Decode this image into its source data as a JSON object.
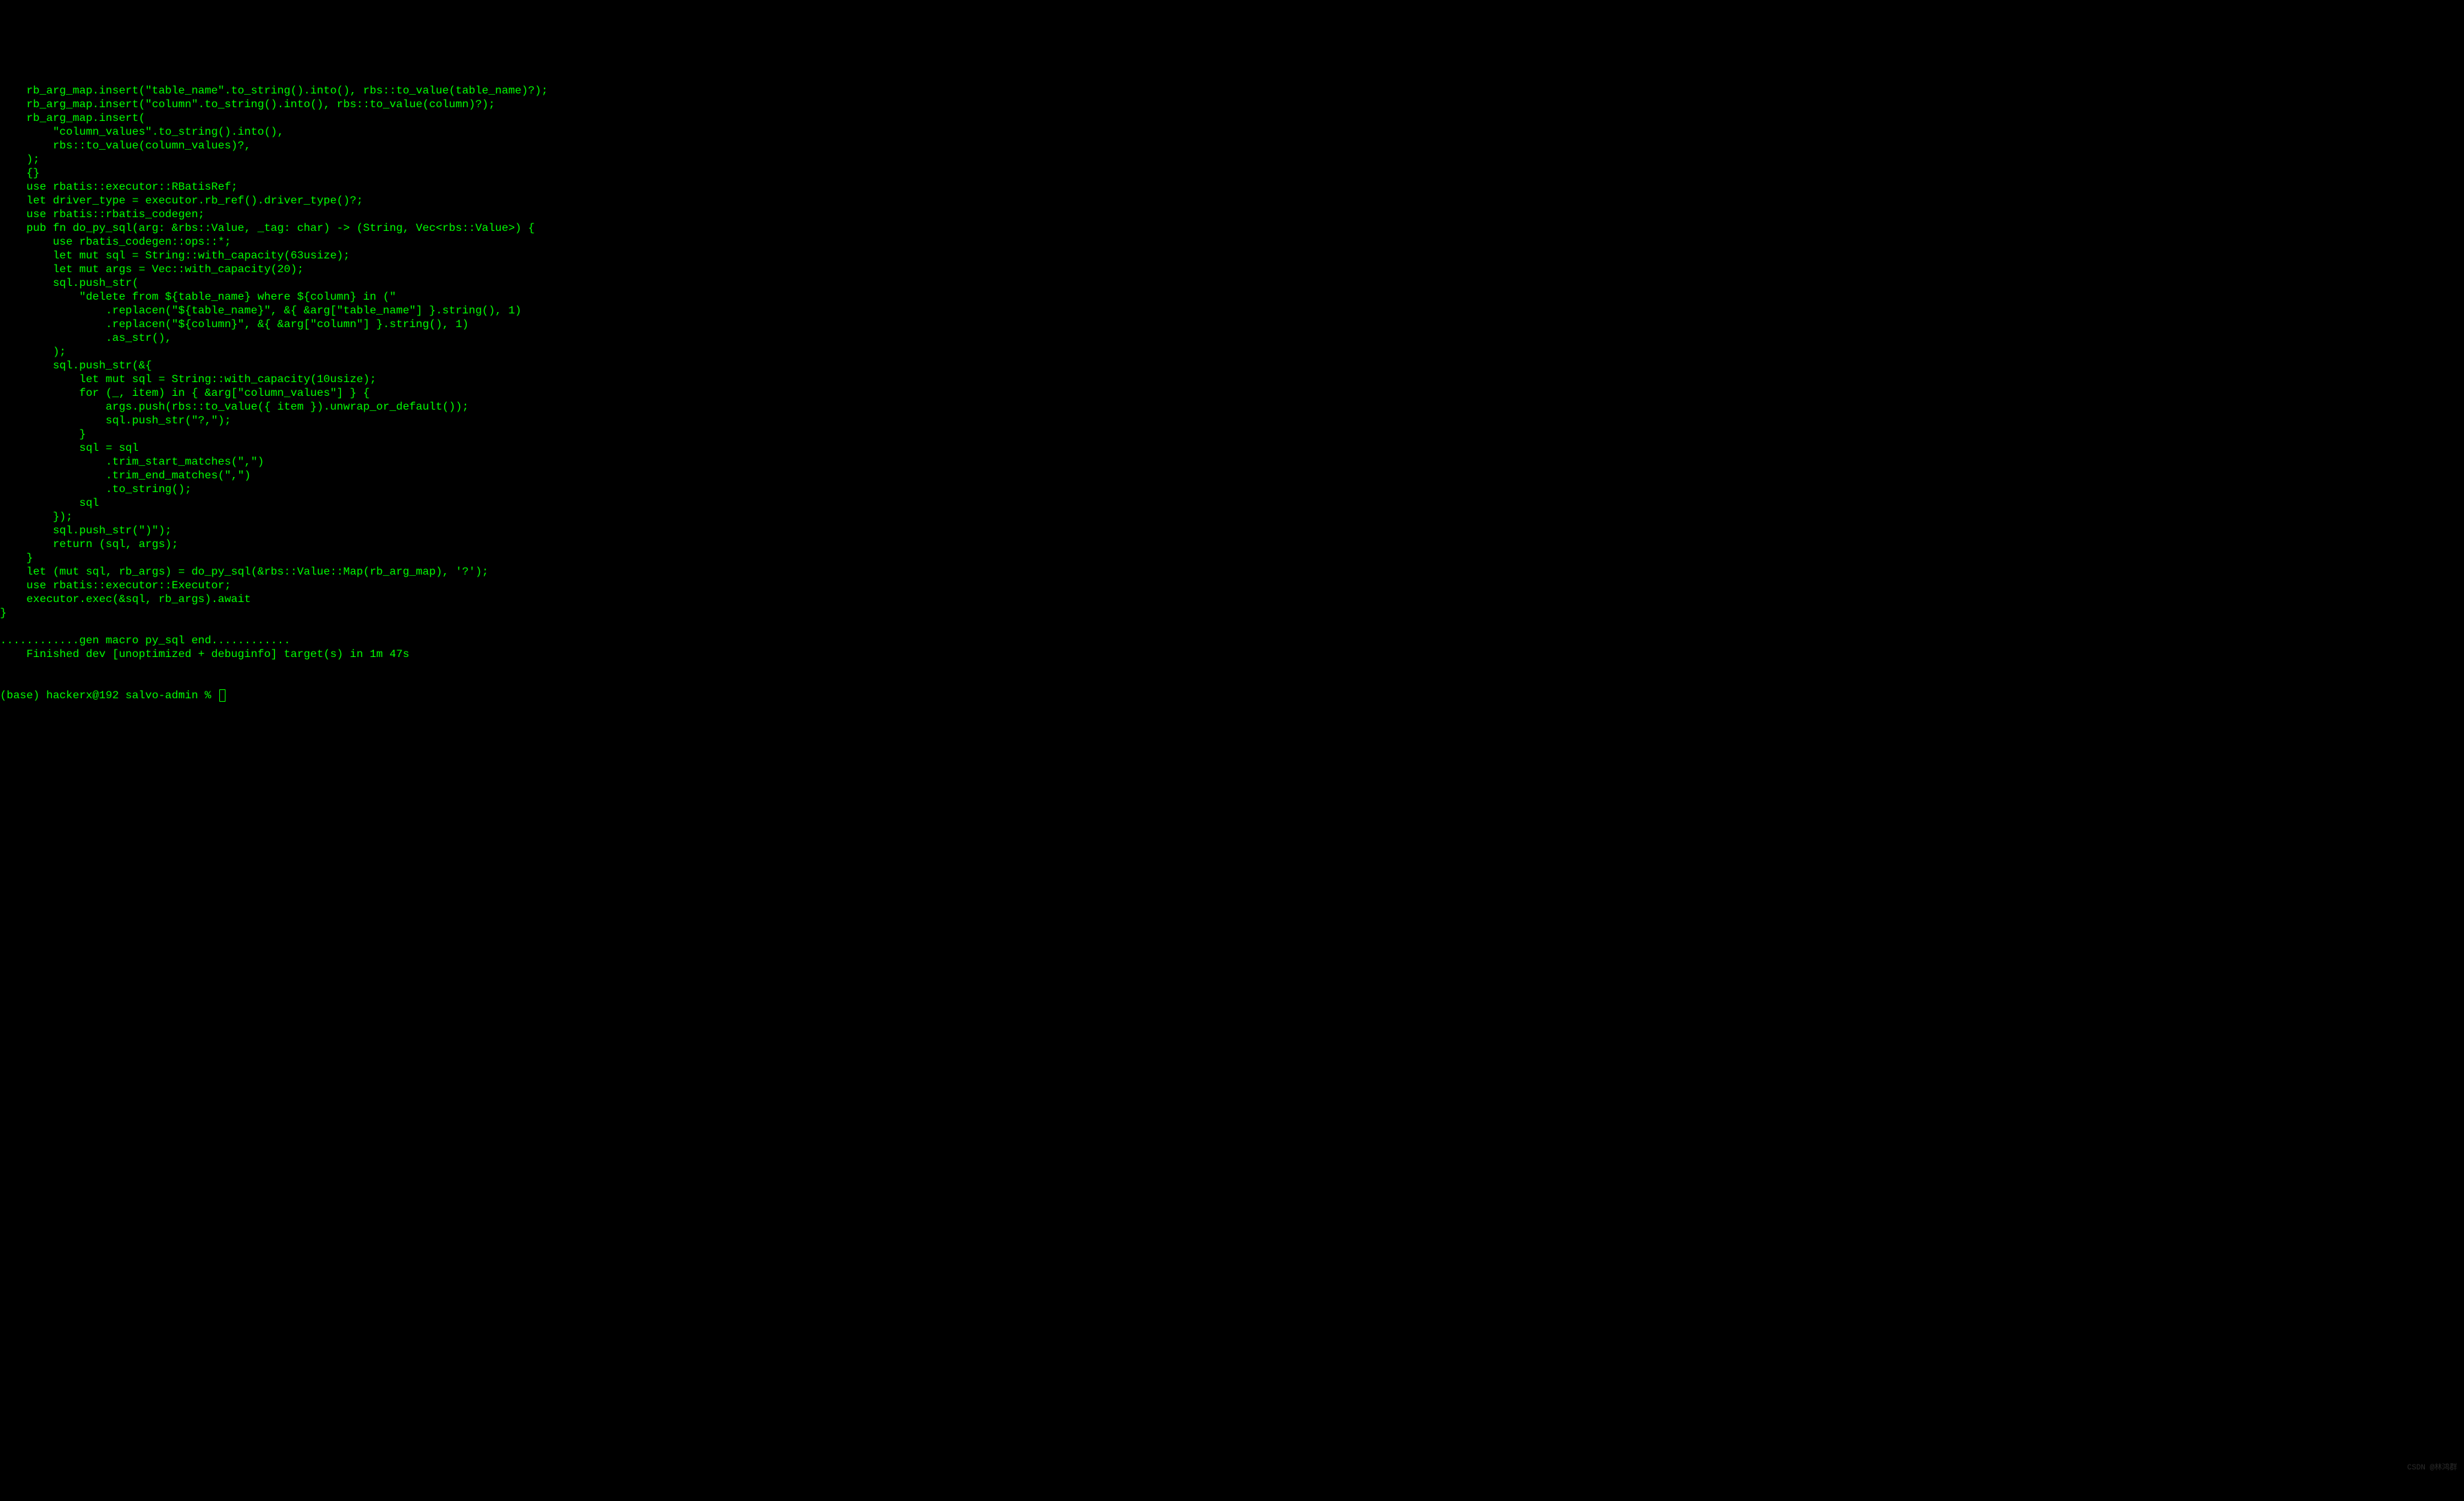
{
  "code_lines": [
    "    rb_arg_map.insert(\"table_name\".to_string().into(), rbs::to_value(table_name)?);",
    "    rb_arg_map.insert(\"column\".to_string().into(), rbs::to_value(column)?);",
    "    rb_arg_map.insert(",
    "        \"column_values\".to_string().into(),",
    "        rbs::to_value(column_values)?,",
    "    );",
    "    {}",
    "    use rbatis::executor::RBatisRef;",
    "    let driver_type = executor.rb_ref().driver_type()?;",
    "    use rbatis::rbatis_codegen;",
    "    pub fn do_py_sql(arg: &rbs::Value, _tag: char) -> (String, Vec<rbs::Value>) {",
    "        use rbatis_codegen::ops::*;",
    "        let mut sql = String::with_capacity(63usize);",
    "        let mut args = Vec::with_capacity(20);",
    "        sql.push_str(",
    "            \"delete from ${table_name} where ${column} in (\"",
    "                .replacen(\"${table_name}\", &{ &arg[\"table_name\"] }.string(), 1)",
    "                .replacen(\"${column}\", &{ &arg[\"column\"] }.string(), 1)",
    "                .as_str(),",
    "        );",
    "        sql.push_str(&{",
    "            let mut sql = String::with_capacity(10usize);",
    "            for (_, item) in { &arg[\"column_values\"] } {",
    "                args.push(rbs::to_value({ item }).unwrap_or_default());",
    "                sql.push_str(\"?,\");",
    "            }",
    "            sql = sql",
    "                .trim_start_matches(\",\")",
    "                .trim_end_matches(\",\")",
    "                .to_string();",
    "            sql",
    "        });",
    "        sql.push_str(\")\");",
    "        return (sql, args);",
    "    }",
    "    let (mut sql, rb_args) = do_py_sql(&rbs::Value::Map(rb_arg_map), '?');",
    "    use rbatis::executor::Executor;",
    "    executor.exec(&sql, rb_args).await",
    "}",
    "",
    "............gen macro py_sql end............",
    "    Finished dev [unoptimized + debuginfo] target(s) in 1m 47s"
  ],
  "prompt": "(base) hackerx@192 salvo-admin % ",
  "watermark": "CSDN @林鸿群"
}
